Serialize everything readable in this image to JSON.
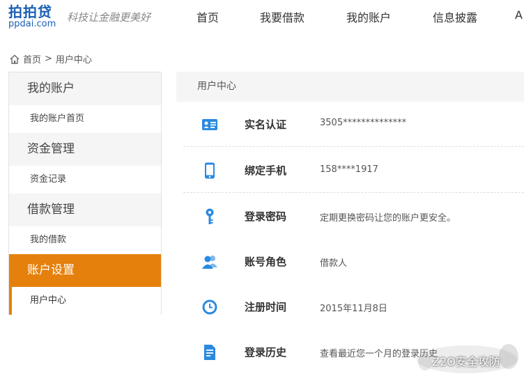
{
  "header": {
    "logo_cn": "拍拍贷",
    "logo_en": "ppdai.com",
    "slogan": "科技让金融更美好",
    "nav": [
      "首页",
      "我要借款",
      "我的账户",
      "信息披露",
      "A"
    ]
  },
  "breadcrumb": {
    "home": "首页",
    "separator": ">",
    "current": "用户中心"
  },
  "sidebar": {
    "groups": [
      {
        "title": "我的账户",
        "item": "我的账户首页"
      },
      {
        "title": "资金管理",
        "item": "资金记录"
      },
      {
        "title": "借款管理",
        "item": "我的借款"
      },
      {
        "title": "账户设置",
        "item": "用户中心"
      }
    ],
    "active_color": "#e5800c"
  },
  "main": {
    "title": "用户中心",
    "rows": [
      {
        "icon": "id-card-icon",
        "label": "实名认证",
        "value": "3505**************"
      },
      {
        "icon": "mobile-phone-icon",
        "label": "绑定手机",
        "value": "158****1917"
      },
      {
        "icon": "key-icon",
        "label": "登录密码",
        "value": "定期更换密码让您的账户更安全。"
      },
      {
        "icon": "users-icon",
        "label": "账号角色",
        "value": "借款人"
      },
      {
        "icon": "clock-icon",
        "label": "注册时间",
        "value": "2015年11月8日"
      },
      {
        "icon": "document-icon",
        "label": "登录历史",
        "value": "查看最近您一个月的登录历史"
      }
    ],
    "icon_color": "#2a8ae0"
  },
  "watermark": {
    "text": "Z2O安全攻防"
  }
}
